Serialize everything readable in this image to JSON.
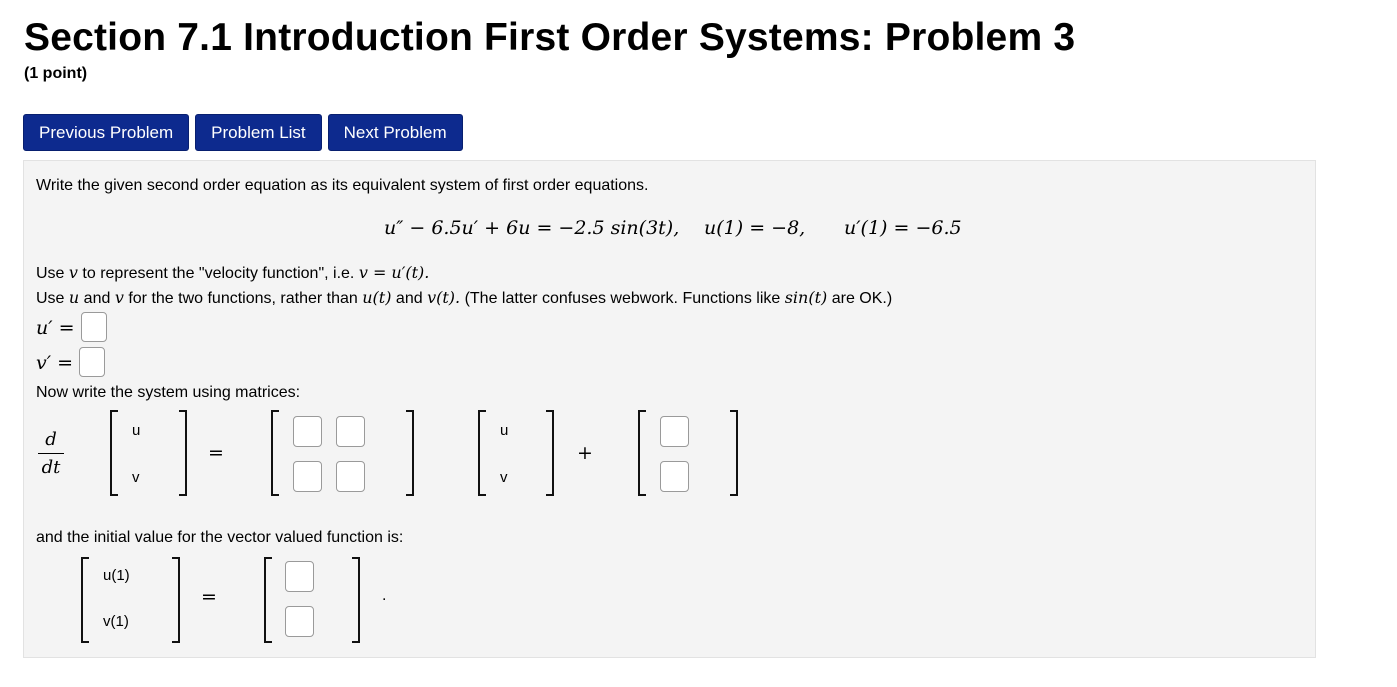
{
  "header": {
    "title": "Section 7.1 Introduction First Order Systems: Problem 3",
    "points": "(1 point)"
  },
  "nav": {
    "previous": "Previous Problem",
    "list": "Problem List",
    "next": "Next Problem"
  },
  "problem": {
    "intro": "Write the given second order equation as its equivalent system of first order equations.",
    "equation": "u″ − 6.5u′ + 6u = −2.5 sin(3t),",
    "ic1": "u(1) = −8,",
    "ic2": "u′(1) = −6.5",
    "line1_a": "Use",
    "line1_var": "v",
    "line1_b": "to represent the \"velocity function\", i.e.",
    "line1_eq": "v = u′(t).",
    "line2_a": "Use",
    "line2_u": "u",
    "line2_and": "and",
    "line2_v": "v",
    "line2_b": "for the two functions, rather than",
    "line2_ut": "u(t)",
    "line2_and2": "and",
    "line2_vt": "v(t).",
    "line2_c": "(The latter confuses webwork. Functions like",
    "line2_sin": "sin(t)",
    "line2_d": "are OK.)",
    "uprime_label": "u′ =",
    "vprime_label": "v′ =",
    "matrix_intro": "Now write the system using matrices:",
    "frac_num": "d",
    "frac_den": "dt",
    "vec_u": "u",
    "vec_v": "v",
    "equals": "=",
    "plus": "+",
    "initial_intro": "and the initial value for the vector valued function is:",
    "u1": "u(1)",
    "v1": "v(1)",
    "period": "."
  },
  "answers": {
    "uprime": "",
    "vprime": "",
    "a11": "",
    "a12": "",
    "a21": "",
    "a22": "",
    "g1": "",
    "g2": "",
    "init1": "",
    "init2": ""
  }
}
